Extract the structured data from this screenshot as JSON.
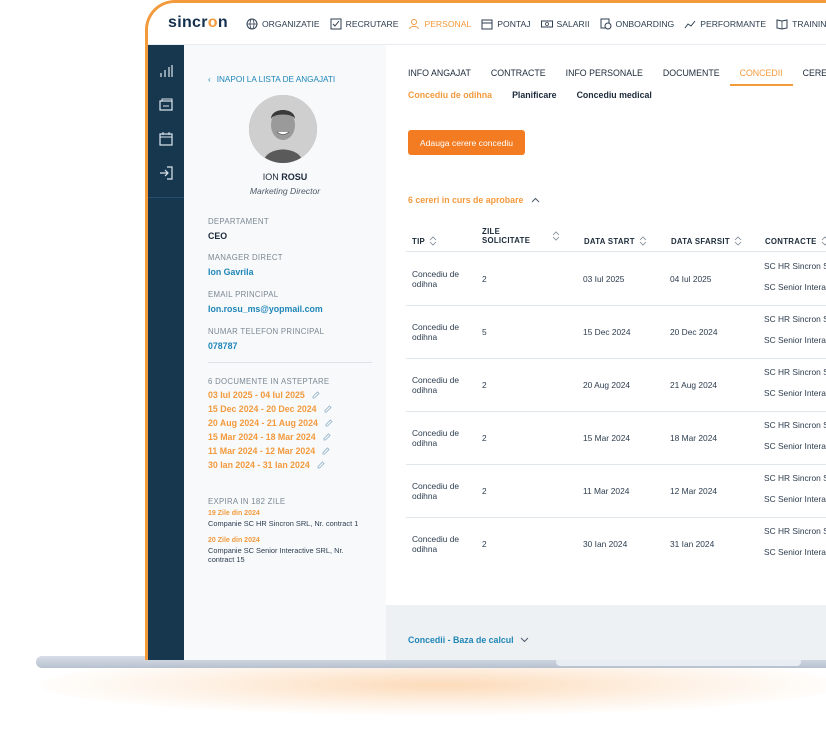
{
  "app": {
    "logo_prefix": "sincr",
    "logo_o": "o",
    "logo_suffix": "n"
  },
  "nav": [
    {
      "label": "ORGANIZATIE",
      "icon": "globe-icon"
    },
    {
      "label": "RECRUTARE",
      "icon": "checkbox-icon"
    },
    {
      "label": "PERSONAL",
      "icon": "user-icon",
      "active": true
    },
    {
      "label": "PONTAJ",
      "icon": "calendar-icon"
    },
    {
      "label": "SALARII",
      "icon": "money-icon"
    },
    {
      "label": "ONBOARDING",
      "icon": "clock-icon"
    },
    {
      "label": "PERFORMANTE",
      "icon": "trend-icon"
    },
    {
      "label": "TRAINING",
      "icon": "book-icon"
    }
  ],
  "profile": {
    "back_label": "INAPOI LA LISTA DE ANGAJATI",
    "first_name": "ION ",
    "last_name": "ROSU",
    "job_title": "Marketing Director",
    "department_label": "DEPARTAMENT",
    "department": "CEO",
    "manager_label": "MANAGER DIRECT",
    "manager": "Ion Gavrila",
    "email_label": "EMAIL PRINCIPAL",
    "email": "Ion.rosu_ms@yopmail.com",
    "phone_label": "NUMAR TELEFON PRINCIPAL",
    "phone": "078787",
    "pending_docs_label": "6 DOCUMENTE IN ASTEPTARE",
    "pending_docs": [
      "03 Iul 2025 - 04 Iul 2025",
      "15 Dec 2024 - 20 Dec 2024",
      "20 Aug 2024 - 21 Aug 2024",
      "15 Mar 2024 - 18 Mar 2024",
      "11 Mar 2024 - 12 Mar 2024",
      "30 Ian 2024 - 31 Ian 2024"
    ],
    "expires_label": "EXPIRA IN 182 ZILE",
    "contracts": [
      {
        "date": "19 Zile din 2024",
        "text": "Companie SC HR Sincron SRL, Nr. contract 1"
      },
      {
        "date": "20 Zile din 2024",
        "text": "Companie SC Senior Interactive SRL, Nr. contract 15"
      }
    ]
  },
  "tabs": [
    {
      "label": "INFO ANGAJAT"
    },
    {
      "label": "CONTRACTE"
    },
    {
      "label": "INFO PERSONALE"
    },
    {
      "label": "DOCUMENTE"
    },
    {
      "label": "CONCEDII",
      "active": true
    },
    {
      "label": "CERERI"
    }
  ],
  "subtabs": [
    {
      "label": "Concediu de odihna",
      "active": true
    },
    {
      "label": "Planificare"
    },
    {
      "label": "Concediu medical"
    }
  ],
  "add_request_label": "Adauga cerere concediu",
  "pending_requests_label": "6 cereri in curs de aprobare",
  "table": {
    "headers": {
      "tip": "TIP",
      "zile1": "ZILE",
      "zile2": "SOLICITATE",
      "start": "DATA START",
      "end": "DATA SFARSIT",
      "contracts": "CONTRACTE"
    },
    "rows": [
      {
        "tip": "Concediu de odihna",
        "zile": "2",
        "start": "03 Iul 2025",
        "end": "04 Iul 2025",
        "c1": "SC HR Sincron S",
        "c2": "SC Senior Intera"
      },
      {
        "tip": "Concediu de odihna",
        "zile": "5",
        "start": "15 Dec 2024",
        "end": "20 Dec 2024",
        "c1": "SC HR Sincron S",
        "c2": "SC Senior Intera"
      },
      {
        "tip": "Concediu de odihna",
        "zile": "2",
        "start": "20 Aug 2024",
        "end": "21 Aug 2024",
        "c1": "SC HR Sincron S",
        "c2": "SC Senior Intera"
      },
      {
        "tip": "Concediu de odihna",
        "zile": "2",
        "start": "15 Mar 2024",
        "end": "18 Mar 2024",
        "c1": "SC HR Sincron S",
        "c2": "SC Senior Intera"
      },
      {
        "tip": "Concediu de odihna",
        "zile": "2",
        "start": "11 Mar 2024",
        "end": "12 Mar 2024",
        "c1": "SC HR Sincron S",
        "c2": "SC Senior Intera"
      },
      {
        "tip": "Concediu de odihna",
        "zile": "2",
        "start": "30 Ian 2024",
        "end": "31 Ian 2024",
        "c1": "SC HR Sincron S",
        "c2": "SC Senior Intera"
      }
    ]
  },
  "base_calc_label": "Concedii - Baza de calcul",
  "colors": {
    "accent": "#f39a3d",
    "button": "#f37b21",
    "link": "#1f86b8",
    "rail": "#17374f"
  }
}
